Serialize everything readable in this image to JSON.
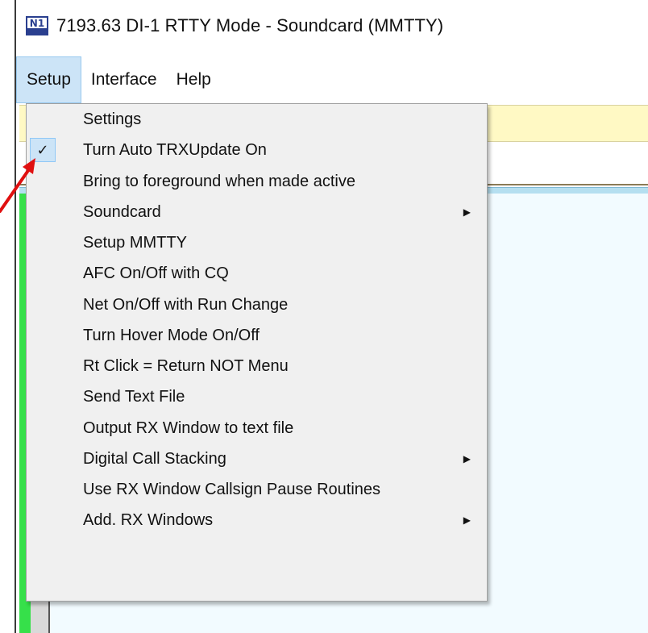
{
  "window": {
    "icon": "n1mm-logo-icon",
    "icon_text": "N1",
    "title": "7193.63  DI-1 RTTY Mode - Soundcard (MMTTY)"
  },
  "menubar": {
    "items": [
      "Setup",
      "Interface",
      "Help"
    ]
  },
  "setup_menu": {
    "items": [
      {
        "label": "Settings",
        "checked": false,
        "submenu": false
      },
      {
        "label": "Turn Auto TRXUpdate On",
        "checked": true,
        "submenu": false
      },
      {
        "label": "Bring to foreground when made active",
        "checked": false,
        "submenu": false
      },
      {
        "label": "Soundcard",
        "checked": false,
        "submenu": true
      },
      {
        "label": "Setup MMTTY",
        "checked": false,
        "submenu": false
      },
      {
        "label": "AFC On/Off with CQ",
        "checked": false,
        "submenu": false
      },
      {
        "label": "Net On/Off with Run Change",
        "checked": false,
        "submenu": false
      },
      {
        "label": "Turn Hover Mode On/Off",
        "checked": false,
        "submenu": false
      },
      {
        "label": "Rt Click = Return NOT Menu",
        "checked": false,
        "submenu": false
      },
      {
        "label": "Send Text File",
        "checked": false,
        "submenu": false
      },
      {
        "label": "Output RX Window to text file",
        "checked": false,
        "submenu": false
      },
      {
        "label": "Digital Call Stacking",
        "checked": false,
        "submenu": true
      },
      {
        "label": "Use RX Window Callsign Pause Routines",
        "checked": false,
        "submenu": false
      },
      {
        "label": "Add. RX Windows",
        "checked": false,
        "submenu": true
      }
    ],
    "check_glyph": "✓",
    "submenu_glyph": "▶"
  },
  "colors": {
    "menu_highlight": "#cce4f7",
    "annotation_arrow": "#e01010",
    "rx_green": "#36e04a",
    "entry_yellow": "#fff9c4"
  }
}
